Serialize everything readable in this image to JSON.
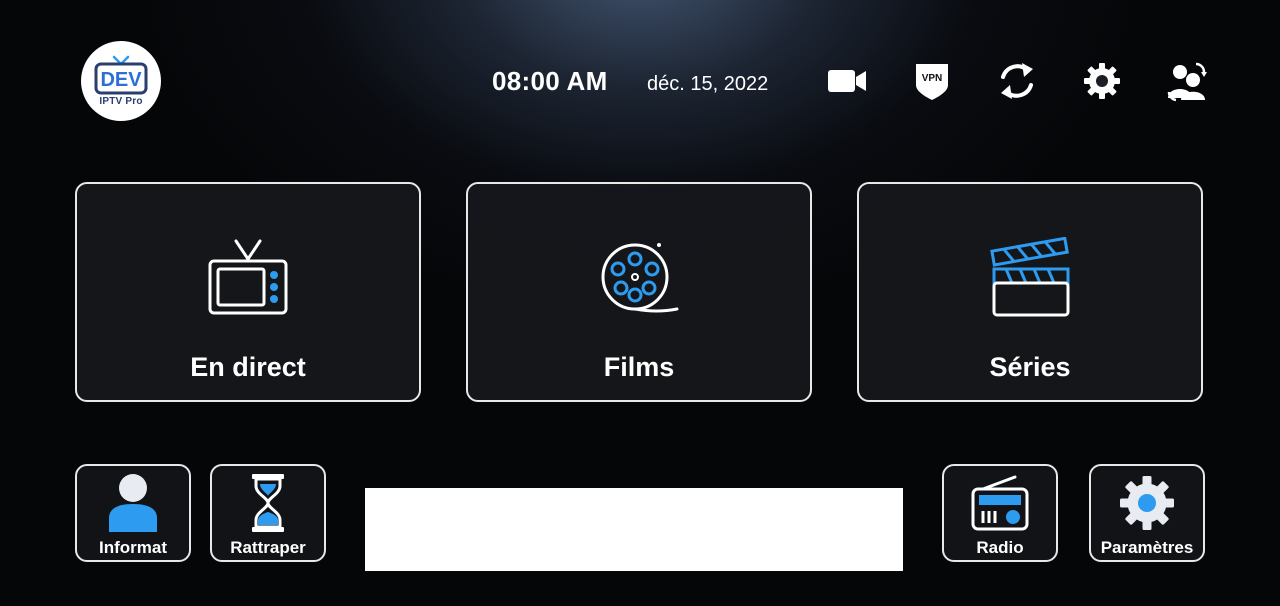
{
  "logo": {
    "brand": "DEV",
    "subtitle": "IPTV Pro"
  },
  "header": {
    "time": "08:00 AM",
    "date": "déc. 15, 2022",
    "icons": [
      "video-camera-icon",
      "vpn-shield-icon",
      "refresh-icon",
      "settings-gear-icon",
      "switch-user-icon"
    ],
    "vpn_label": "VPN"
  },
  "tiles": [
    {
      "label": "En direct",
      "icon": "tv-icon"
    },
    {
      "label": "Films",
      "icon": "film-reel-icon"
    },
    {
      "label": "Séries",
      "icon": "clapperboard-icon"
    }
  ],
  "small_tiles": [
    {
      "label": "Informat",
      "icon": "user-icon"
    },
    {
      "label": "Rattraper",
      "icon": "hourglass-icon"
    },
    {
      "label": "Radio",
      "icon": "radio-icon"
    },
    {
      "label": "Paramètres",
      "icon": "gear-icon"
    }
  ],
  "colors": {
    "accent": "#2d9cf0",
    "border": "#e8e8e8",
    "background": "#050608"
  }
}
